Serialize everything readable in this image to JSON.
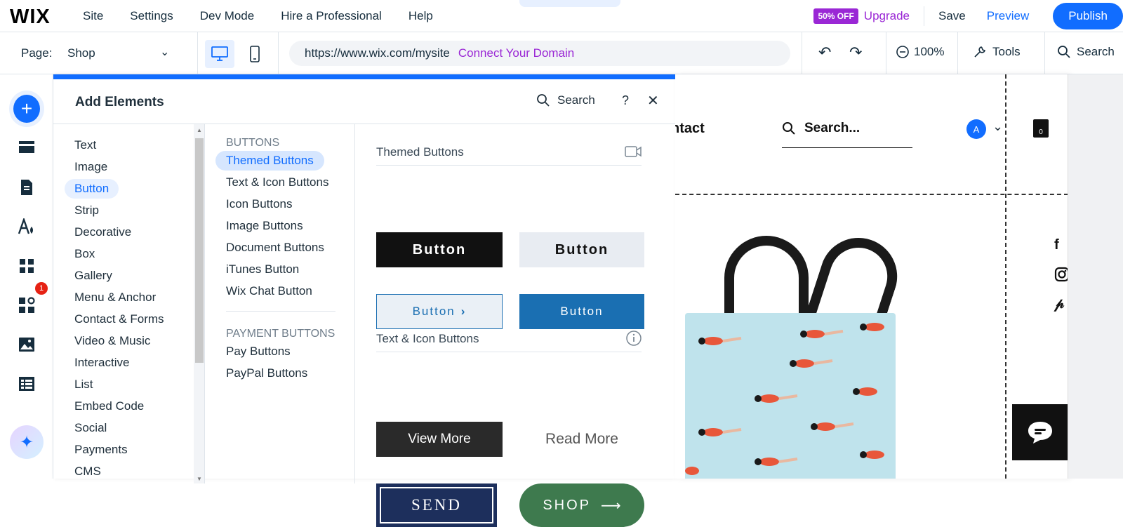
{
  "topbar": {
    "logo": "WIX",
    "menu": [
      "Site",
      "Settings",
      "Dev Mode",
      "Hire a Professional",
      "Help"
    ],
    "discount_badge": "50% OFF",
    "upgrade": "Upgrade",
    "save": "Save",
    "preview": "Preview",
    "publish": "Publish"
  },
  "toolbar": {
    "page_label": "Page:",
    "page_value": "Shop",
    "url": "https://www.wix.com/mysite",
    "connect_domain": "Connect Your Domain",
    "zoom": "100%",
    "tools": "Tools",
    "search": "Search"
  },
  "rail": {
    "notification_count": "1"
  },
  "panel": {
    "title": "Add Elements",
    "search": "Search",
    "help": "?",
    "categories": [
      "Text",
      "Image",
      "Button",
      "Strip",
      "Decorative",
      "Box",
      "Gallery",
      "Menu & Anchor",
      "Contact & Forms",
      "Video & Music",
      "Interactive",
      "List",
      "Embed Code",
      "Social",
      "Payments",
      "CMS"
    ],
    "selected_category": "Button",
    "sub": {
      "buttons_header": "BUTTONS",
      "buttons": [
        "Themed Buttons",
        "Text & Icon Buttons",
        "Icon Buttons",
        "Image Buttons",
        "Document Buttons",
        "iTunes Button",
        "Wix Chat Button"
      ],
      "payment_header": "PAYMENT BUTTONS",
      "payment": [
        "Pay Buttons",
        "PayPal Buttons"
      ]
    },
    "gallery": {
      "section1_title": "Themed Buttons",
      "section2_title": "Text & Icon Buttons",
      "b1": "Button",
      "b2": "Button",
      "b3": "Button",
      "b4": "Button",
      "b5": "View More",
      "b6": "Read More",
      "b7": "SEND",
      "b8": "SHOP"
    }
  },
  "canvas": {
    "nav_partial": "ntact",
    "search_placeholder": "Search...",
    "avatar_letter": "A",
    "cart_count": "0"
  },
  "colors": {
    "accent": "#116dff",
    "upgrade": "#9a27d5"
  }
}
